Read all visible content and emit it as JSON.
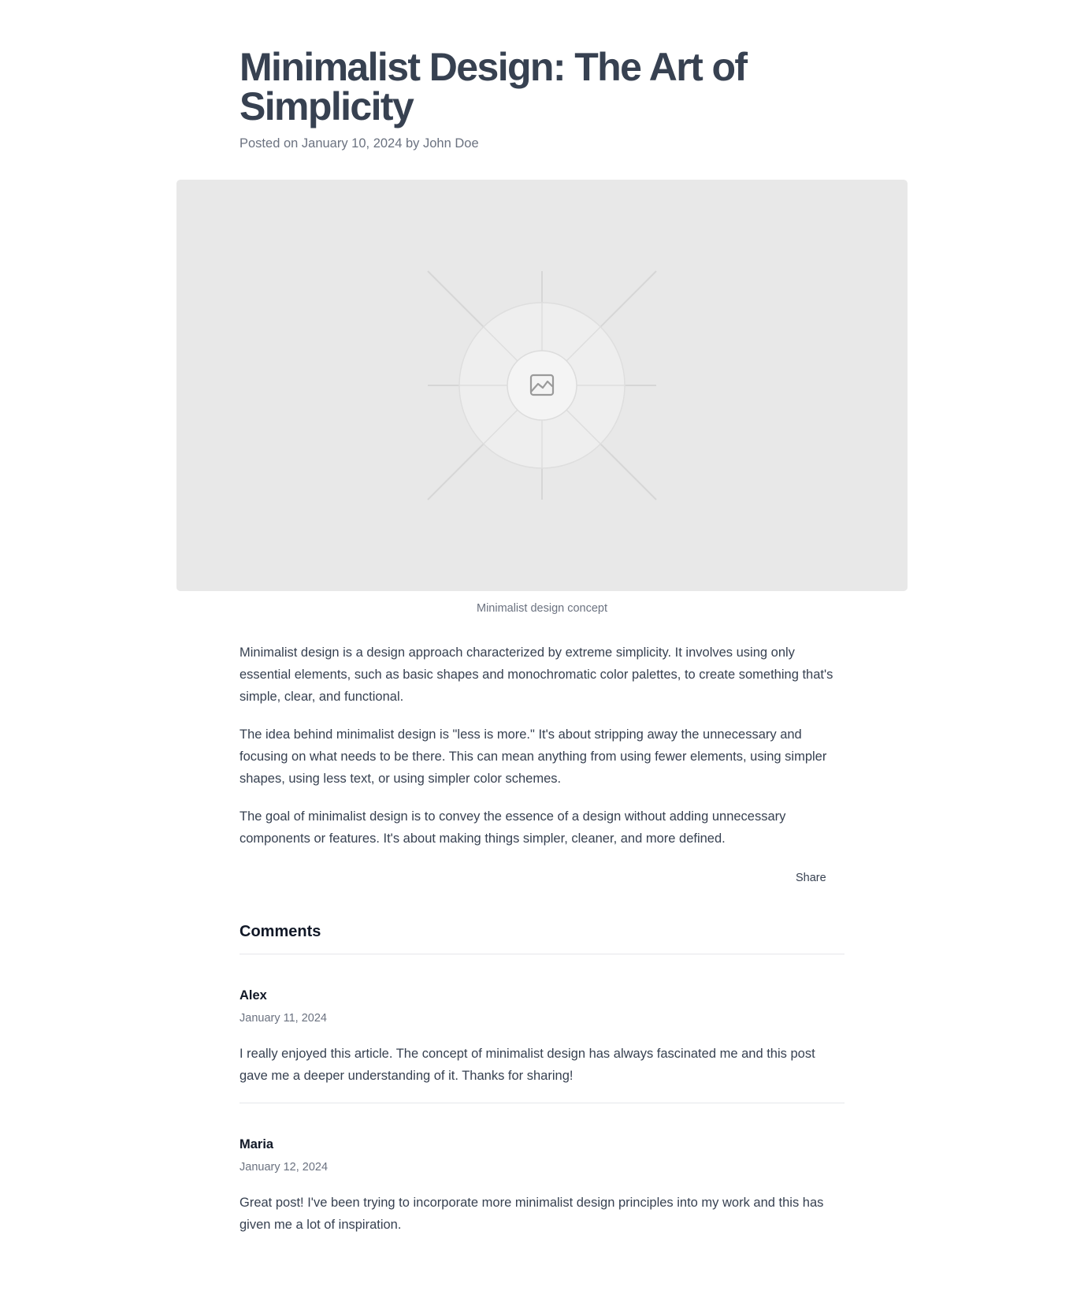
{
  "post": {
    "title": "Minimalist Design: The Art of Simplicity",
    "meta": "Posted on January 10, 2024 by John Doe",
    "figure": {
      "icon": "image-placeholder-icon",
      "caption": "Minimalist design concept"
    },
    "paragraphs": [
      "Minimalist design is a design approach characterized by extreme simplicity. It involves using only essential elements, such as basic shapes and monochromatic color palettes, to create something that's simple, clear, and functional.",
      "The idea behind minimalist design is \"less is more.\" It's about stripping away the unnecessary and focusing on what needs to be there. This can mean anything from using fewer elements, using simpler shapes, using less text, or using simpler color schemes.",
      "The goal of minimalist design is to convey the essence of a design without adding unnecessary components or features. It's about making things simpler, cleaner, and more defined."
    ],
    "share_label": "Share"
  },
  "comments": {
    "heading": "Comments",
    "items": [
      {
        "author": "Alex",
        "date": "January 11, 2024",
        "text": "I really enjoyed this article. The concept of minimalist design has always fascinated me and this post gave me a deeper understanding of it. Thanks for sharing!"
      },
      {
        "author": "Maria",
        "date": "January 12, 2024",
        "text": "Great post! I've been trying to incorporate more minimalist design principles into my work and this has given me a lot of inspiration."
      }
    ]
  },
  "colors": {
    "heading": "#374151",
    "body_text": "#374151",
    "muted_text": "#6b7280",
    "figure_bg": "#e8e8e8",
    "divider": "#e5e7eb"
  }
}
